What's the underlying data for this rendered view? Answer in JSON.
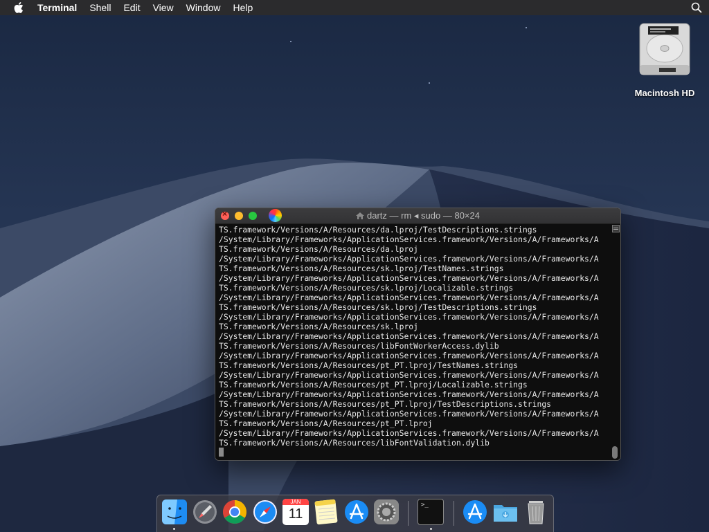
{
  "menubar": {
    "app_name": "Terminal",
    "items": [
      "Shell",
      "Edit",
      "View",
      "Window",
      "Help"
    ]
  },
  "desktop": {
    "drive_label": "Macintosh HD"
  },
  "terminal": {
    "title": "dartz — rm ◂ sudo — 80×24",
    "lines": [
      "TS.framework/Versions/A/Resources/da.lproj/TestDescriptions.strings",
      "/System/Library/Frameworks/ApplicationServices.framework/Versions/A/Frameworks/A",
      "TS.framework/Versions/A/Resources/da.lproj",
      "/System/Library/Frameworks/ApplicationServices.framework/Versions/A/Frameworks/A",
      "TS.framework/Versions/A/Resources/sk.lproj/TestNames.strings",
      "/System/Library/Frameworks/ApplicationServices.framework/Versions/A/Frameworks/A",
      "TS.framework/Versions/A/Resources/sk.lproj/Localizable.strings",
      "/System/Library/Frameworks/ApplicationServices.framework/Versions/A/Frameworks/A",
      "TS.framework/Versions/A/Resources/sk.lproj/TestDescriptions.strings",
      "/System/Library/Frameworks/ApplicationServices.framework/Versions/A/Frameworks/A",
      "TS.framework/Versions/A/Resources/sk.lproj",
      "/System/Library/Frameworks/ApplicationServices.framework/Versions/A/Frameworks/A",
      "TS.framework/Versions/A/Resources/libFontWorkerAccess.dylib",
      "/System/Library/Frameworks/ApplicationServices.framework/Versions/A/Frameworks/A",
      "TS.framework/Versions/A/Resources/pt_PT.lproj/TestNames.strings",
      "/System/Library/Frameworks/ApplicationServices.framework/Versions/A/Frameworks/A",
      "TS.framework/Versions/A/Resources/pt_PT.lproj/Localizable.strings",
      "/System/Library/Frameworks/ApplicationServices.framework/Versions/A/Frameworks/A",
      "TS.framework/Versions/A/Resources/pt_PT.lproj/TestDescriptions.strings",
      "/System/Library/Frameworks/ApplicationServices.framework/Versions/A/Frameworks/A",
      "TS.framework/Versions/A/Resources/pt_PT.lproj",
      "/System/Library/Frameworks/ApplicationServices.framework/Versions/A/Frameworks/A",
      "TS.framework/Versions/A/Resources/libFontValidation.dylib"
    ]
  },
  "dock": {
    "calendar_month": "JAN",
    "calendar_day": "11",
    "terminal_glyph": ">_",
    "icons": [
      "finder-icon",
      "launchpad-icon",
      "chrome-icon",
      "safari-icon",
      "calendar-icon",
      "notes-icon",
      "app-store-icon",
      "system-preferences-icon",
      "terminal-icon",
      "app-store-icon",
      "downloads-folder-icon",
      "trash-icon"
    ]
  },
  "colors": {
    "close": "#fe5f57",
    "minimize": "#febc2e",
    "zoom": "#28c840",
    "menubar": "#2b2b2d",
    "terminal_bg": "#0e0e0e"
  }
}
